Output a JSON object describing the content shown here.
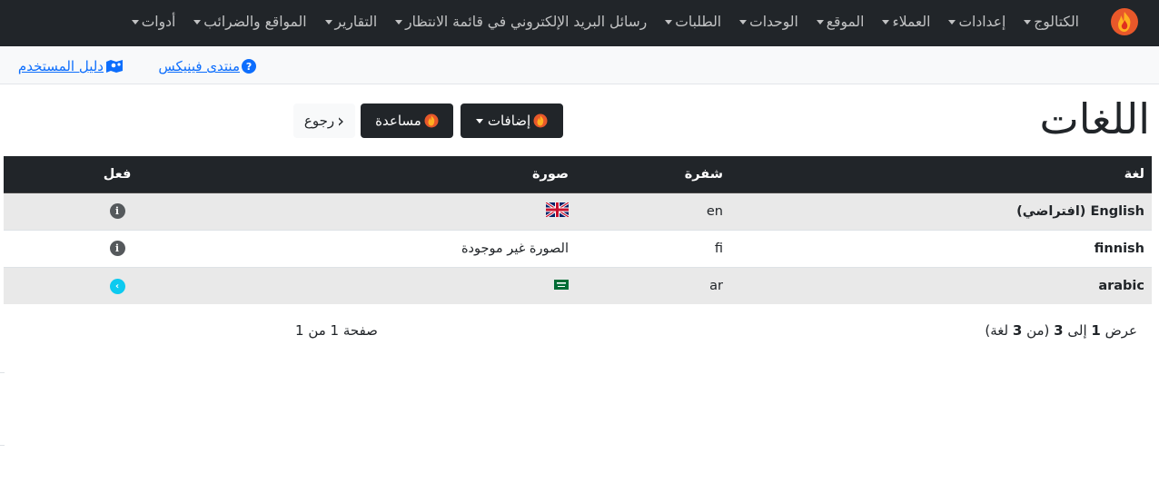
{
  "nav": {
    "items": [
      {
        "label": "الكتالوج",
        "dropdown": true
      },
      {
        "label": "إعدادات",
        "dropdown": true
      },
      {
        "label": "العملاء",
        "dropdown": true
      },
      {
        "label": "الموقع",
        "dropdown": true
      },
      {
        "label": "الوحدات",
        "dropdown": true
      },
      {
        "label": "الطلبات",
        "dropdown": true
      },
      {
        "label": "رسائل البريد الإلكتروني في قائمة الانتظار",
        "dropdown": true
      },
      {
        "label": "التقارير",
        "dropdown": true
      },
      {
        "label": "المواقع والضرائب",
        "dropdown": true
      },
      {
        "label": "أدوات",
        "dropdown": true
      }
    ]
  },
  "subbar": {
    "user_guide": "دليل المستخدم",
    "forum": "منتدى فينيكس",
    "help_glyph": "?"
  },
  "page": {
    "title": "اللغات",
    "add_button": "إضافات",
    "help_button": "مساعدة",
    "back_button": "رجوع",
    "back_glyph": "‹"
  },
  "table": {
    "headers": {
      "lang": "لغة",
      "code": "شفرة",
      "image": "صورة",
      "action": "فعل"
    },
    "rows": [
      {
        "name": "English (افتراضي)",
        "code": "en",
        "image": "flag-uk",
        "action": "info"
      },
      {
        "name": "finnish",
        "code": "fi",
        "image_text": "الصورة غير موجودة",
        "action": "info"
      },
      {
        "name": "arabic",
        "code": "ar",
        "image": "flag-sa",
        "action": "arrow"
      }
    ]
  },
  "footer": {
    "info_prefix": "عرض",
    "from": "1",
    "to_word": "إلى",
    "to": "3",
    "of_open": "(من",
    "total": "3",
    "of_close": "لغة)",
    "page_label": "صفحة 1 من 1"
  },
  "colors": {
    "navbar": "#212529",
    "link": "#0d6efd",
    "stripe": "#e9e9e9",
    "info_icon": "#55595c",
    "arrow_icon": "#0dcaf0"
  }
}
